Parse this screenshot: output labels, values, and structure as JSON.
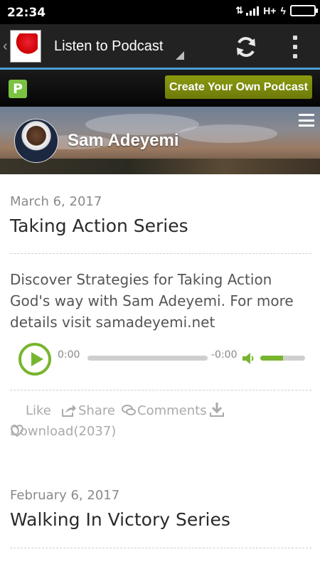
{
  "status_bar": {
    "time": "22:34",
    "network": "H+"
  },
  "app_bar": {
    "title": "Listen to Podcast"
  },
  "podomatic": {
    "logo_letter": "P",
    "create_label": "Create Your Own Podcast"
  },
  "banner": {
    "name": "Sam Adeyemi"
  },
  "episodes": [
    {
      "date": "March 6, 2017",
      "title": "Taking Action Series",
      "description": "Discover Strategies for Taking Action God's way with Sam Adeyemi. For more details visit samadeyemi.net",
      "player": {
        "current_time": "0:00",
        "remaining_time": "-0:00",
        "volume_level": 0.5
      },
      "actions": {
        "like": "Like",
        "share": "Share",
        "comments": "Comments",
        "download": "Download(2037)"
      }
    },
    {
      "date": "February 6, 2017",
      "title": "Walking In Victory Series"
    }
  ],
  "colors": {
    "accent_green": "#78b52e",
    "create_button": "#7a880c",
    "app_bar_underline": "#4a9fd5"
  },
  "icons": [
    "refresh-icon",
    "overflow-menu-icon",
    "hamburger-icon",
    "play-icon",
    "volume-icon",
    "heart-icon",
    "share-icon",
    "comments-icon",
    "download-icon"
  ]
}
